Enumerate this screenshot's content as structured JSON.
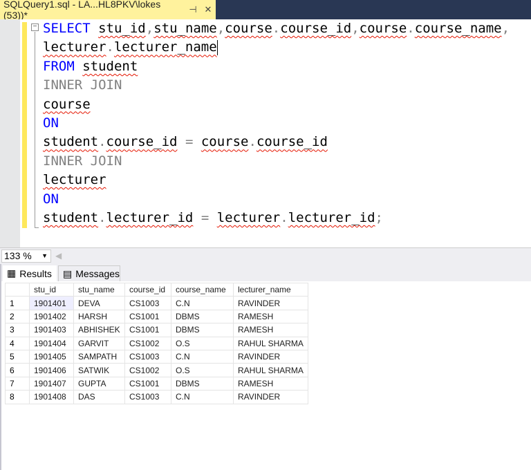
{
  "document_tab": {
    "title": "SQLQuery1.sql - LA...HL8PKV\\lokes (53))*",
    "pin_icon": "pin-icon",
    "close_icon": "close-icon"
  },
  "editor": {
    "lines": [
      [
        {
          "t": "SELECT",
          "c": "kw"
        },
        {
          "t": " "
        },
        {
          "t": "stu_id",
          "s": 1
        },
        {
          "t": ",",
          "c": "gr"
        },
        {
          "t": "stu_name",
          "s": 1
        },
        {
          "t": ",",
          "c": "gr"
        },
        {
          "t": "course",
          "s": 1
        },
        {
          "t": ".",
          "c": "gr"
        },
        {
          "t": "course_id",
          "s": 1
        },
        {
          "t": ",",
          "c": "gr"
        },
        {
          "t": "course",
          "s": 1
        },
        {
          "t": ".",
          "c": "gr"
        },
        {
          "t": "course_name",
          "s": 1
        },
        {
          "t": ",",
          "c": "gr"
        }
      ],
      [
        {
          "t": "lecturer",
          "s": 1
        },
        {
          "t": ".",
          "c": "gr"
        },
        {
          "t": "lecturer_name",
          "s": 1
        }
      ],
      [
        {
          "t": "FROM",
          "c": "kw"
        },
        {
          "t": " "
        },
        {
          "t": "student",
          "s": 1
        }
      ],
      [
        {
          "t": "INNER JOIN",
          "c": "gr"
        }
      ],
      [
        {
          "t": "course",
          "s": 1
        }
      ],
      [
        {
          "t": "ON",
          "c": "kw"
        }
      ],
      [
        {
          "t": "student",
          "s": 1
        },
        {
          "t": ".",
          "c": "gr"
        },
        {
          "t": "course_id",
          "s": 1
        },
        {
          "t": " "
        },
        {
          "t": "=",
          "c": "gr"
        },
        {
          "t": " "
        },
        {
          "t": "course",
          "s": 1
        },
        {
          "t": ".",
          "c": "gr"
        },
        {
          "t": "course_id",
          "s": 1
        }
      ],
      [
        {
          "t": "INNER JOIN",
          "c": "gr"
        }
      ],
      [
        {
          "t": "lecturer",
          "s": 1
        }
      ],
      [
        {
          "t": "ON",
          "c": "kw"
        }
      ],
      [
        {
          "t": "student",
          "s": 1
        },
        {
          "t": ".",
          "c": "gr"
        },
        {
          "t": "lecturer_id",
          "s": 1
        },
        {
          "t": " "
        },
        {
          "t": "=",
          "c": "gr"
        },
        {
          "t": " "
        },
        {
          "t": "lecturer",
          "s": 1
        },
        {
          "t": ".",
          "c": "gr"
        },
        {
          "t": "lecturer_id",
          "s": 1
        },
        {
          "t": ";",
          "c": "gr"
        }
      ]
    ]
  },
  "zoom": {
    "value": "133 %"
  },
  "results": {
    "tabs": [
      {
        "label": "Results",
        "icon": "grid-icon"
      },
      {
        "label": "Messages",
        "icon": "messages-icon"
      }
    ],
    "columns": [
      "stu_id",
      "stu_name",
      "course_id",
      "course_name",
      "lecturer_name"
    ],
    "rows": [
      [
        "1",
        "1901401",
        "DEVA",
        "CS1003",
        "C.N",
        "RAVINDER"
      ],
      [
        "2",
        "1901402",
        "HARSH",
        "CS1001",
        "DBMS",
        "RAMESH"
      ],
      [
        "3",
        "1901403",
        "ABHISHEK",
        "CS1001",
        "DBMS",
        "RAMESH"
      ],
      [
        "4",
        "1901404",
        "GARVIT",
        "CS1002",
        "O.S",
        "RAHUL SHARMA"
      ],
      [
        "5",
        "1901405",
        "SAMPATH",
        "CS1003",
        "C.N",
        "RAVINDER"
      ],
      [
        "6",
        "1901406",
        "SATWIK",
        "CS1002",
        "O.S",
        "RAHUL SHARMA"
      ],
      [
        "7",
        "1901407",
        "GUPTA",
        "CS1001",
        "DBMS",
        "RAMESH"
      ],
      [
        "8",
        "1901408",
        "DAS",
        "CS1003",
        "C.N",
        "RAVINDER"
      ]
    ]
  }
}
